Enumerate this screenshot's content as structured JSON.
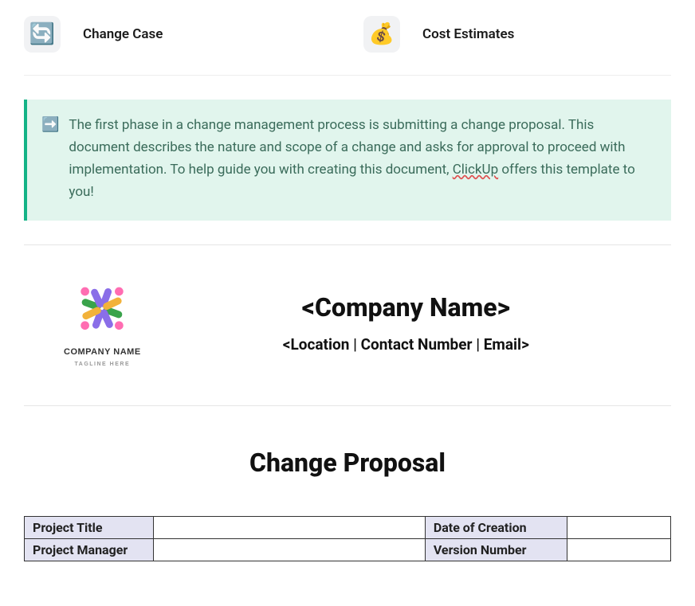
{
  "nav": [
    {
      "icon": "🔄",
      "label": "Change Case"
    },
    {
      "icon": "💰",
      "label": "Cost Estimates"
    }
  ],
  "callout": {
    "icon": "➡️",
    "text_pre": "The first phase in a change management process is submitting a change proposal. This document describes the nature and scope of a change and asks for approval to proceed with implementation. To help guide you with creating this document, ",
    "link": "ClickUp",
    "text_post": " offers this template to you!"
  },
  "logo": {
    "caption": "COMPANY NAME",
    "tagline": "TAGLINE HERE"
  },
  "company": {
    "name": "<Company Name>",
    "sub": "<Location | Contact Number | Email>"
  },
  "doc_title": "Change Proposal",
  "meta": {
    "r0c0": "Project Title",
    "r0c1": "",
    "r0c2": "Date of Creation",
    "r0c3": "",
    "r1c0": "Project Manager",
    "r1c1": "",
    "r1c2": "Version Number",
    "r1c3": ""
  }
}
